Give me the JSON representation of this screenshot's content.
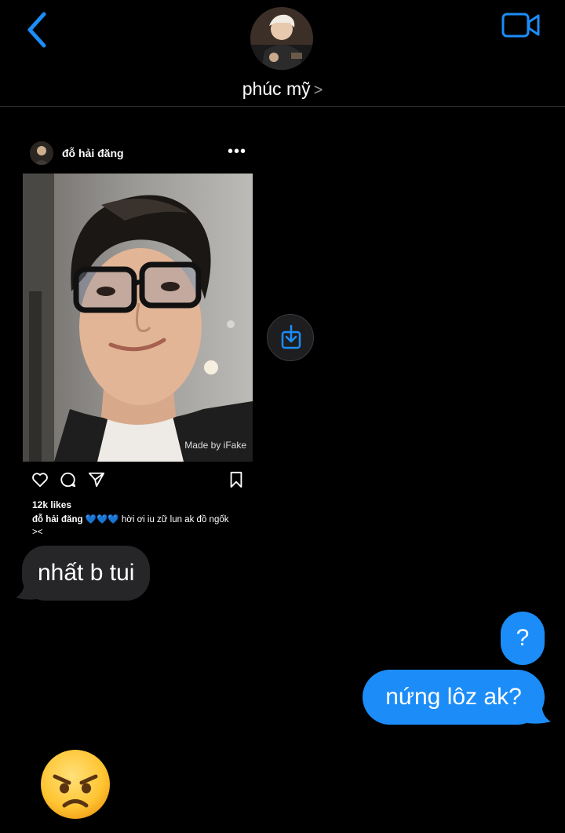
{
  "header": {
    "contact_name": "phúc mỹ",
    "chevron": ">",
    "avatar_icon": "profile-photo"
  },
  "shared_post": {
    "username": "đỗ hải đăng",
    "more": "•••",
    "watermark": "Made by iFake",
    "likes": "12k likes",
    "caption_user": "đỗ hải đăng",
    "caption_emojis": "💙💙💙",
    "caption_text": "hời ơi iu zữ lun ak đồ ngốk",
    "caption_text_2": "><"
  },
  "messages": [
    {
      "side": "incoming",
      "text": "nhất b tui"
    },
    {
      "side": "outgoing",
      "text": "?"
    },
    {
      "side": "outgoing",
      "text": "nứng lôz ak?"
    }
  ],
  "reaction_emoji": "angry-face",
  "colors": {
    "background": "#000000",
    "accent_blue": "#1c8df8",
    "incoming_bubble": "#262628"
  }
}
